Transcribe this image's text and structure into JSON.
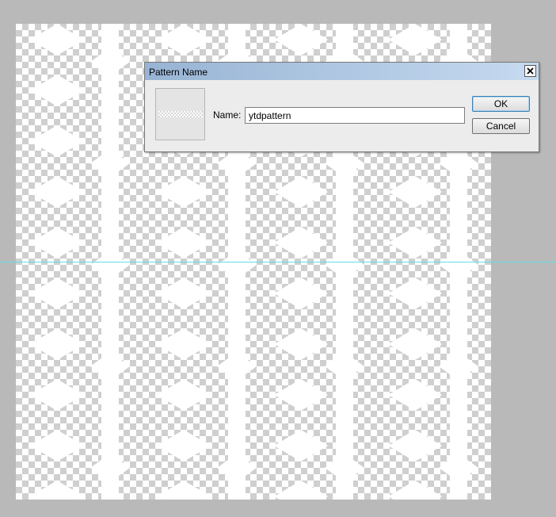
{
  "dialog": {
    "title": "Pattern Name",
    "close_icon": "close-x-icon",
    "name_label": "Name:",
    "name_value": "ytdpattern",
    "ok_label": "OK",
    "cancel_label": "Cancel"
  },
  "colors": {
    "workspace": "#b9b9b9",
    "guide": "#5fe0e6",
    "titlebar_start": "#98b4d4",
    "titlebar_end": "#c6daf0"
  }
}
